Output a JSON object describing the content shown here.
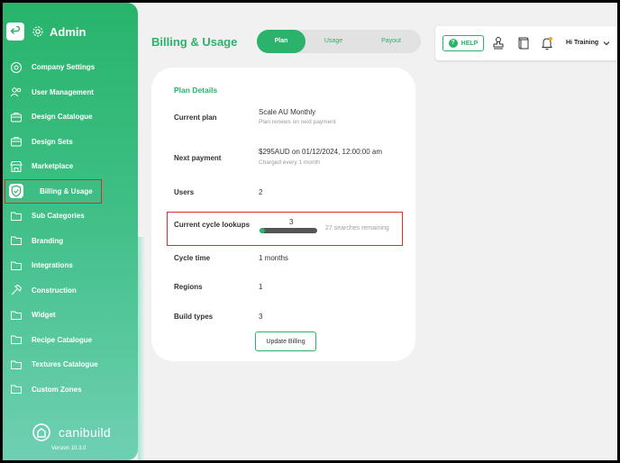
{
  "sidebar": {
    "title": "Admin",
    "items": [
      {
        "label": "Company Settings",
        "icon": "settings-icon"
      },
      {
        "label": "User Management",
        "icon": "users-icon"
      },
      {
        "label": "Design Catalogue",
        "icon": "briefcase-icon"
      },
      {
        "label": "Design Sets",
        "icon": "briefcase-icon"
      },
      {
        "label": "Marketplace",
        "icon": "store-icon"
      },
      {
        "label": "Billing & Usage",
        "icon": "shield-check-icon",
        "active": true
      },
      {
        "label": "Sub Categories",
        "icon": "folder-icon"
      },
      {
        "label": "Branding",
        "icon": "folder-icon"
      },
      {
        "label": "Integrations",
        "icon": "folder-icon"
      },
      {
        "label": "Construction",
        "icon": "hammer-icon"
      },
      {
        "label": "Widget",
        "icon": "folder-icon"
      },
      {
        "label": "Recipe Catalogue",
        "icon": "folder-icon"
      },
      {
        "label": "Textures Catalogue",
        "icon": "folder-icon"
      },
      {
        "label": "Custom Zones",
        "icon": "folder-icon"
      }
    ],
    "logo_text": "canibuild",
    "version": "Version 10.3.0"
  },
  "header": {
    "page_title": "Billing & Usage",
    "tabs": [
      {
        "label": "Plan",
        "active": true
      },
      {
        "label": "Usage",
        "active": false
      },
      {
        "label": "Payout",
        "active": false
      }
    ],
    "help_label": "HELP",
    "user_name": "Hi Training"
  },
  "plan": {
    "title": "Plan Details",
    "current_plan_label": "Current plan",
    "current_plan_value": "Scale AU Monthly",
    "current_plan_sub": "Plan renews on next payment",
    "next_payment_label": "Next payment",
    "next_payment_value": "$295AUD on 01/12/2024, 12:00:00 am",
    "next_payment_sub": "Charged every 1 month",
    "users_label": "Users",
    "users_value": "2",
    "lookups_label": "Current cycle lookups",
    "lookups_count": "3",
    "lookups_progress": 0.1,
    "lookups_remaining": "27 searches remaining",
    "cycle_time_label": "Cycle time",
    "cycle_time_value": "1 months",
    "regions_label": "Regions",
    "regions_value": "1",
    "build_types_label": "Build types",
    "build_types_value": "3",
    "update_button": "Update Billing"
  },
  "colors": {
    "accent": "#2bb26b",
    "highlight": "#d32f2f",
    "progress_track": "#555555"
  }
}
